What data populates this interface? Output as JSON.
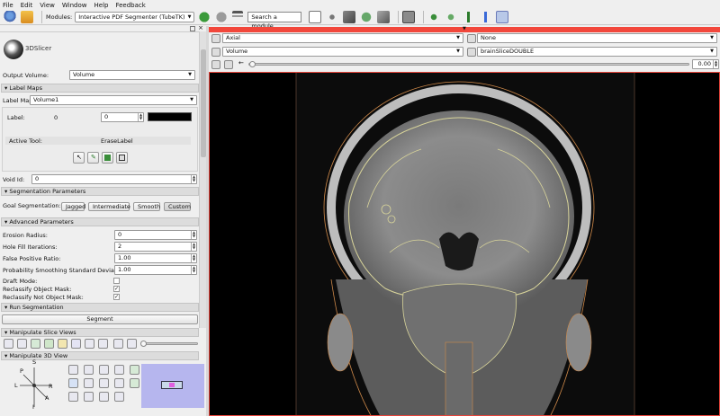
{
  "menu": {
    "file": "File",
    "edit": "Edit",
    "view": "View",
    "window": "Window",
    "help": "Help",
    "feedback": "Feedback"
  },
  "toolbar": {
    "modules_label": "Modules:",
    "module_value": "Interactive PDF Segmenter (TubeTK)",
    "search_placeholder": "Search a module"
  },
  "logo": {
    "text": "3DSlicer"
  },
  "panel": {
    "output_volume_label": "Output Volume:",
    "output_volume_value": "Volume",
    "label_maps_header": "Label Maps",
    "label_map_label": "Label Map:",
    "label_map_value": "Volume1",
    "label_label": "Label:",
    "label_value": "0",
    "label_spin_value": "0",
    "active_tool_label": "Active Tool:",
    "active_tool_value": "EraseLabel",
    "void_id_label": "Void Id:",
    "void_id_value": "0",
    "seg_params_header": "Segmentation Parameters",
    "goal_seg_label": "Goal Segmentation:",
    "goal_buttons": [
      "Jagged",
      "Intermediate",
      "Smooth",
      "Custom"
    ],
    "adv_params_header": "Advanced Parameters",
    "erosion_label": "Erosion Radius:",
    "erosion_value": "0",
    "holefill_label": "Hole Fill Iterations:",
    "holefill_value": "2",
    "fpr_label": "False Positive Ratio:",
    "fpr_value": "1.00",
    "prob_label": "Probability Smoothing Standard Deviation:",
    "prob_value": "1.00",
    "draft_label": "Draft Mode:",
    "reclass_obj_label": "Reclassify Object Mask:",
    "reclass_notobj_label": "Reclassify Not Object Mask:",
    "check_mark": "✓",
    "run_header": "Run Segmentation",
    "segment_button": "Segment",
    "slice_views_header": "Manipulate Slice Views",
    "view3d_header": "Manipulate 3D View"
  },
  "axes": {
    "s": "S",
    "p": "P",
    "l": "L",
    "r": "R",
    "a": "A",
    "i": "I"
  },
  "viewer_controls": {
    "orientation": "Axial",
    "fg_volume": "None",
    "bg_volume": "Volume",
    "label_volume": "brainSliceDOUBLE",
    "slider_value": "0.00",
    "minus_glyph": "←"
  },
  "colors": {
    "accent_red": "#f2473b",
    "seg_outline": "#d8d49a",
    "label_outline": "#e08a3a",
    "view3d_bg": "#b6b6ee"
  }
}
